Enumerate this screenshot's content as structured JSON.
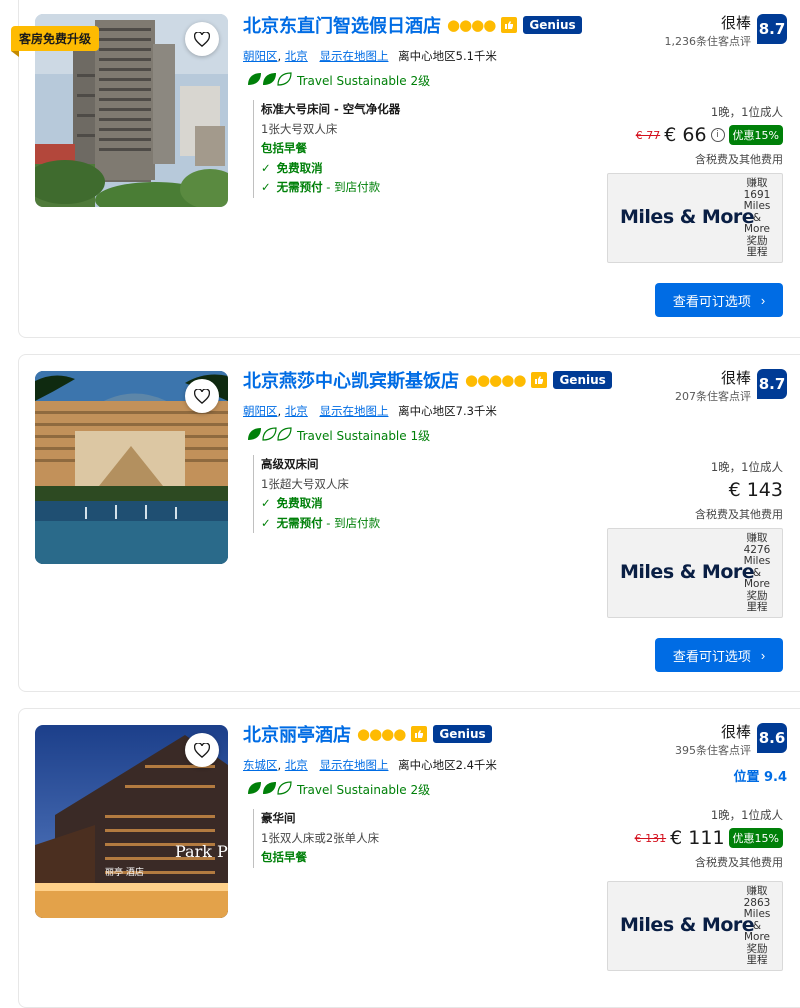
{
  "hotels": [
    {
      "ribbon": "客房免费升级",
      "name": "北京东直门智选假日酒店",
      "stars": "●●●●",
      "genius": "Genius",
      "district": "朝阳区",
      "city": "北京",
      "map_link": "显示在地图上",
      "distance": "离中心地区5.1千米",
      "sustainable": "Travel Sustainable 2级",
      "room_name": "标准大号床间 - 空气净化器",
      "bed": "1张大号双人床",
      "breakfast": "包括早餐",
      "perk1": "免费取消",
      "perk2_bold": "无需预付",
      "perk2_rest": " - 到店付款",
      "score_word": "很棒",
      "reviews": "1,236条住客点评",
      "score": "8.7",
      "nights": "1晚，1位成人",
      "old_price": "€ 77",
      "price": "€ 66",
      "deal": "优惠15%",
      "taxes": "含税费及其他费用",
      "miles_logo": "Miles & More",
      "miles_earn": "赚取 1691 Miles & More 奖励 里程",
      "cta": "查看可订选项"
    },
    {
      "name": "北京燕莎中心凯宾斯基饭店",
      "stars": "●●●●●",
      "genius": "Genius",
      "district": "朝阳区",
      "city": "北京",
      "map_link": "显示在地图上",
      "distance": "离中心地区7.3千米",
      "sustainable": "Travel Sustainable 1级",
      "room_name": "高级双床间",
      "bed": "1张超大号双人床",
      "perk1": "免费取消",
      "perk2_bold": "无需预付",
      "perk2_rest": " - 到店付款",
      "score_word": "很棒",
      "reviews": "207条住客点评",
      "score": "8.7",
      "nights": "1晚，1位成人",
      "price": "€ 143",
      "taxes": "含税费及其他费用",
      "miles_logo": "Miles & More",
      "miles_earn": "赚取 4276 Miles & More 奖励 里程",
      "cta": "查看可订选项"
    },
    {
      "name": "北京丽亭酒店",
      "stars": "●●●●",
      "genius": "Genius",
      "district": "东城区",
      "city": "北京",
      "map_link": "显示在地图上",
      "distance": "离中心地区2.4千米",
      "sustainable": "Travel Sustainable 2级",
      "room_name": "豪华间",
      "bed": "1张双人床或2张单人床",
      "breakfast": "包括早餐",
      "score_word": "很棒",
      "reviews": "395条住客点评",
      "score": "8.6",
      "subscore": "位置 9.4",
      "nights": "1晚，1位成人",
      "old_price": "€ 131",
      "price": "€ 111",
      "deal": "优惠15%",
      "taxes": "含税费及其他费用",
      "miles_logo": "Miles & More",
      "miles_earn": "赚取 2863 Miles & More 奖励 里程",
      "photo_sign": "Park Pl",
      "photo_sign2": "丽亭 酒店"
    }
  ],
  "colors": {
    "link": "#006ce4",
    "brand": "#003b95",
    "green": "#008009",
    "star": "#febb02"
  }
}
